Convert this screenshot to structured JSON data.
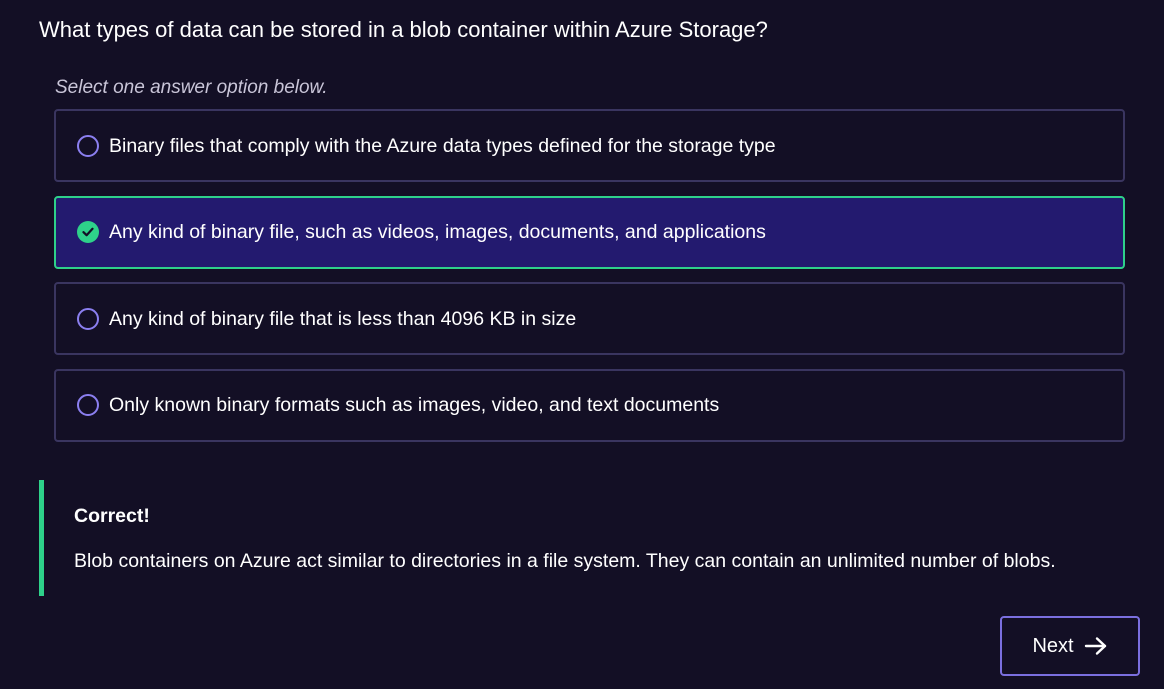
{
  "question": {
    "text": "What types of data can be stored in a blob container within Azure Storage?",
    "hint": "Select one answer option below."
  },
  "options": [
    {
      "label": "Binary files that comply with the Azure data types defined for the storage type",
      "selected": false
    },
    {
      "label": "Any kind of binary file, such as videos, images, documents, and applications",
      "selected": true
    },
    {
      "label": "Any kind of binary file that is less than 4096 KB in size",
      "selected": false
    },
    {
      "label": "Only known binary formats such as images, video, and text documents",
      "selected": false
    }
  ],
  "feedback": {
    "title": "Correct!",
    "text": "Blob containers on Azure act similar to directories in a file system. They can contain an unlimited number of blobs."
  },
  "navigation": {
    "next_label": "Next",
    "next_icon": "arrow-right-icon"
  },
  "colors": {
    "background": "#130f25",
    "selected_background": "#231a6f",
    "correct_accent": "#2ed18a",
    "radio_border": "#8b7ff0",
    "option_border": "#3a3560",
    "button_border": "#7b6fe0"
  }
}
